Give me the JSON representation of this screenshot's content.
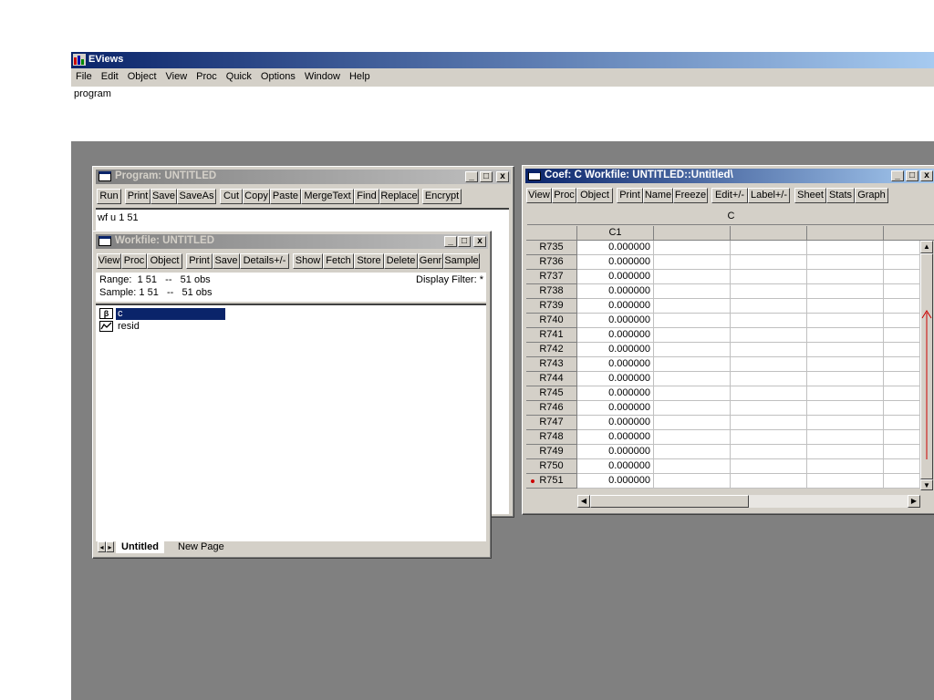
{
  "app": {
    "title": "EViews",
    "menu": [
      "File",
      "Edit",
      "Object",
      "View",
      "Proc",
      "Quick",
      "Options",
      "Window",
      "Help"
    ],
    "command_text": "program"
  },
  "program_window": {
    "title": "Program: UNTITLED",
    "toolbar": [
      "Run",
      "Print",
      "Save",
      "SaveAs",
      "Cut",
      "Copy",
      "Paste",
      "MergeText",
      "Find",
      "Replace",
      "Encrypt"
    ],
    "code": "wf u 1 51"
  },
  "workfile_window": {
    "title": "Workfile: UNTITLED",
    "toolbar": [
      "View",
      "Proc",
      "Object",
      "Print",
      "Save",
      "Details+/-",
      "Show",
      "Fetch",
      "Store",
      "Delete",
      "Genr",
      "Sample"
    ],
    "range": "Range:  1 51   --   51 obs",
    "sample": "Sample: 1 51   --   51 obs",
    "display_filter": "Display Filter: *",
    "items": [
      {
        "name": "c",
        "icon": "coef-icon",
        "selected": true
      },
      {
        "name": "resid",
        "icon": "series-icon",
        "selected": false
      }
    ],
    "tabs": [
      "Untitled",
      "New Page"
    ]
  },
  "coef_window": {
    "title": "Coef: C   Workfile: UNTITLED::Untitled\\",
    "toolbar": [
      "View",
      "Proc",
      "Object",
      "Print",
      "Name",
      "Freeze",
      "Edit+/-",
      "Label+/-",
      "Sheet",
      "Stats",
      "Graph"
    ],
    "header": "C",
    "column": "C1",
    "rows": [
      {
        "label": "R735",
        "value": "0.000000"
      },
      {
        "label": "R736",
        "value": "0.000000"
      },
      {
        "label": "R737",
        "value": "0.000000"
      },
      {
        "label": "R738",
        "value": "0.000000"
      },
      {
        "label": "R739",
        "value": "0.000000"
      },
      {
        "label": "R740",
        "value": "0.000000"
      },
      {
        "label": "R741",
        "value": "0.000000"
      },
      {
        "label": "R742",
        "value": "0.000000"
      },
      {
        "label": "R743",
        "value": "0.000000"
      },
      {
        "label": "R744",
        "value": "0.000000"
      },
      {
        "label": "R745",
        "value": "0.000000"
      },
      {
        "label": "R746",
        "value": "0.000000"
      },
      {
        "label": "R747",
        "value": "0.000000"
      },
      {
        "label": "R748",
        "value": "0.000000"
      },
      {
        "label": "R749",
        "value": "0.000000"
      },
      {
        "label": "R750",
        "value": "0.000000"
      },
      {
        "label": "R751",
        "value": "0.000000",
        "marked": true
      }
    ]
  },
  "colors": {
    "title_active": "#0a246a",
    "title_gradient_end": "#a6caf0",
    "desktop": "#808080",
    "face": "#d4d0c8",
    "marker": "#cc0000"
  }
}
